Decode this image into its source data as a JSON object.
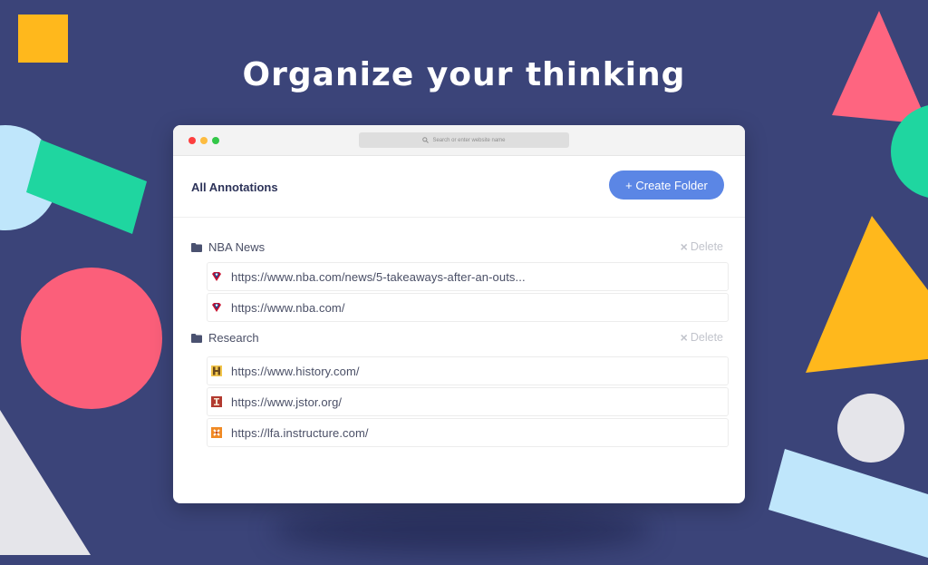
{
  "headline": "Organize your thinking",
  "browser": {
    "address_placeholder": "Search or enter website name"
  },
  "panel": {
    "title": "All Annotations",
    "create_folder_label": "+ Create Folder"
  },
  "folders": [
    {
      "name": "NBA News",
      "delete_label": "Delete",
      "items": [
        {
          "url": "https://www.nba.com/news/5-takeaways-after-an-outs...",
          "icon": "nba-favicon-icon"
        },
        {
          "url": "https://www.nba.com/",
          "icon": "nba-favicon-icon"
        }
      ]
    },
    {
      "name": "Research",
      "delete_label": "Delete",
      "items": [
        {
          "url": "https://www.history.com/",
          "icon": "history-favicon-icon"
        },
        {
          "url": "https://www.jstor.org/",
          "icon": "jstor-favicon-icon"
        },
        {
          "url": "https://lfa.instructure.com/",
          "icon": "instructure-favicon-icon"
        }
      ]
    }
  ],
  "colors": {
    "background": "#3b4479",
    "accent_button": "#5b86e5",
    "title_text": "#2d3359"
  }
}
